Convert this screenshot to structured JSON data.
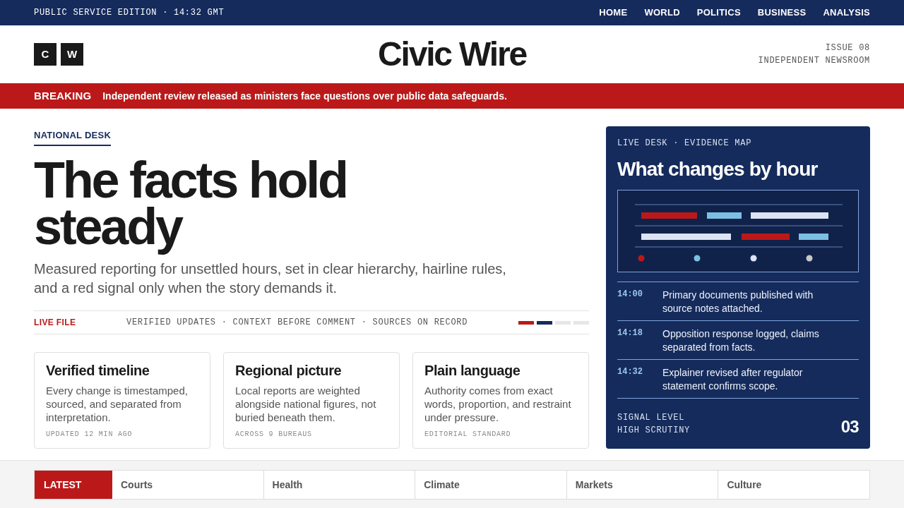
{
  "top_bar": {
    "edition": "PUBLIC SERVICE EDITION · 14:32 GMT",
    "nav": [
      "HOME",
      "WORLD",
      "POLITICS",
      "BUSINESS",
      "ANALYSIS"
    ]
  },
  "masthead": {
    "logo_letters": [
      "C",
      "W"
    ],
    "title": "Civic Wire",
    "issue": "ISSUE 08",
    "tagline": "INDEPENDENT NEWSROOM"
  },
  "breaking": {
    "label": "BREAKING",
    "text": "Independent review released as ministers face questions over public data safeguards."
  },
  "lead": {
    "kicker": "NATIONAL DESK",
    "headline": "The facts hold steady",
    "dek": "Measured reporting for unsettled hours, set in clear hierarchy, hairline rules, and a red signal only when the story demands it."
  },
  "live_file": {
    "label": "LIVE FILE",
    "text": "VERIFIED UPDATES · CONTEXT BEFORE COMMENT · SOURCES ON RECORD",
    "segments": [
      {
        "color": "#bb1919"
      },
      {
        "color": "#152b5c"
      },
      {
        "color": "#e6e6e6"
      },
      {
        "color": "#e6e6e6"
      }
    ]
  },
  "cards": [
    {
      "title": "Verified timeline",
      "body": "Every change is timestamped, sourced, and separated from interpretation.",
      "meta": "UPDATED 12 MIN AGO"
    },
    {
      "title": "Regional picture",
      "body": "Local reports are weighted alongside national figures, not buried beneath them.",
      "meta": "ACROSS 9 BUREAUS"
    },
    {
      "title": "Plain language",
      "body": "Authority comes from exact words, proportion, and restraint under pressure.",
      "meta": "EDITORIAL STANDARD"
    }
  ],
  "live_desk": {
    "eyebrow": "LIVE DESK · EVIDENCE MAP",
    "title": "What changes by hour",
    "timeline": [
      {
        "time": "14:00",
        "text": "Primary documents published with source notes attached."
      },
      {
        "time": "14:18",
        "text": "Opposition response logged, claims separated from facts."
      },
      {
        "time": "14:32",
        "text": "Explainer revised after regulator statement confirms scope."
      }
    ],
    "signal_label": "SIGNAL LEVEL",
    "signal_value": "HIGH SCRUTINY",
    "signal_number": "03"
  },
  "section_bar": {
    "label": "LATEST",
    "sections": [
      "Courts",
      "Health",
      "Climate",
      "Markets",
      "Culture"
    ]
  }
}
